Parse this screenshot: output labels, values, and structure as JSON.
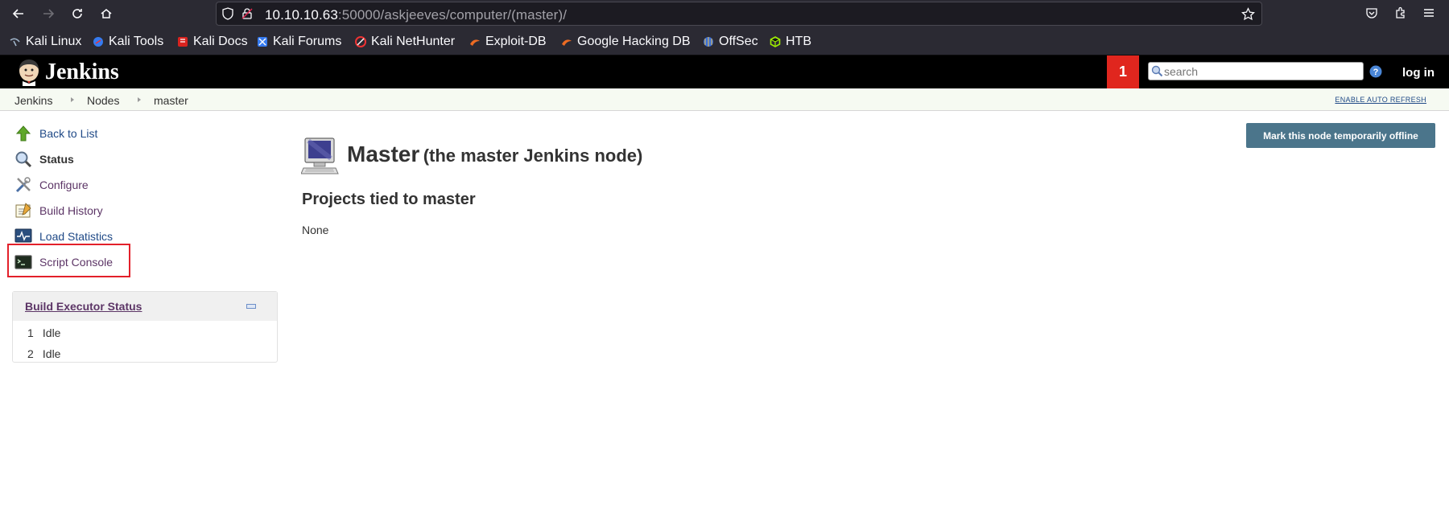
{
  "browser": {
    "url_host": "10.10.10.63",
    "url_rest": ":50000/askjeeves/computer/(master)/",
    "bookmarks": [
      {
        "label": "Kali Linux",
        "icon": "kali-dragon-icon"
      },
      {
        "label": "Kali Tools",
        "icon": "kali-tools-icon"
      },
      {
        "label": "Kali Docs",
        "icon": "kali-docs-icon"
      },
      {
        "label": "Kali Forums",
        "icon": "kali-forums-icon"
      },
      {
        "label": "Kali NetHunter",
        "icon": "kali-nethunter-icon"
      },
      {
        "label": "Exploit-DB",
        "icon": "exploit-db-icon"
      },
      {
        "label": "Google Hacking DB",
        "icon": "ghdb-icon"
      },
      {
        "label": "OffSec",
        "icon": "offsec-icon"
      },
      {
        "label": "HTB",
        "icon": "htb-icon"
      }
    ]
  },
  "header": {
    "title": "Jenkins",
    "notification_count": "1",
    "search_placeholder": "search",
    "login_label": "log in"
  },
  "breadcrumb": {
    "items": [
      "Jenkins",
      "Nodes",
      "master"
    ],
    "auto_refresh": "ENABLE AUTO REFRESH"
  },
  "sidebar": {
    "tasks": [
      {
        "label": "Back to List",
        "icon": "up-arrow-icon"
      },
      {
        "label": "Status",
        "icon": "magnifier-icon"
      },
      {
        "label": "Configure",
        "icon": "tools-icon"
      },
      {
        "label": "Build History",
        "icon": "notepad-icon"
      },
      {
        "label": "Load Statistics",
        "icon": "monitor-graph-icon"
      },
      {
        "label": "Script Console",
        "icon": "terminal-icon"
      }
    ],
    "executor": {
      "title": "Build Executor Status",
      "rows": [
        {
          "num": "1",
          "status": "Idle"
        },
        {
          "num": "2",
          "status": "Idle"
        }
      ]
    }
  },
  "main": {
    "offline_button": "Mark this node temporarily offline",
    "title": "Master",
    "subtitle": "(the master Jenkins node)",
    "projects_heading": "Projects tied to master",
    "projects_value": "None"
  },
  "colors": {
    "jenkins_header": "#000000",
    "notification": "#e0261e",
    "link": "#204a87",
    "offline_button": "#4b758b",
    "highlight": "#e3202a"
  }
}
